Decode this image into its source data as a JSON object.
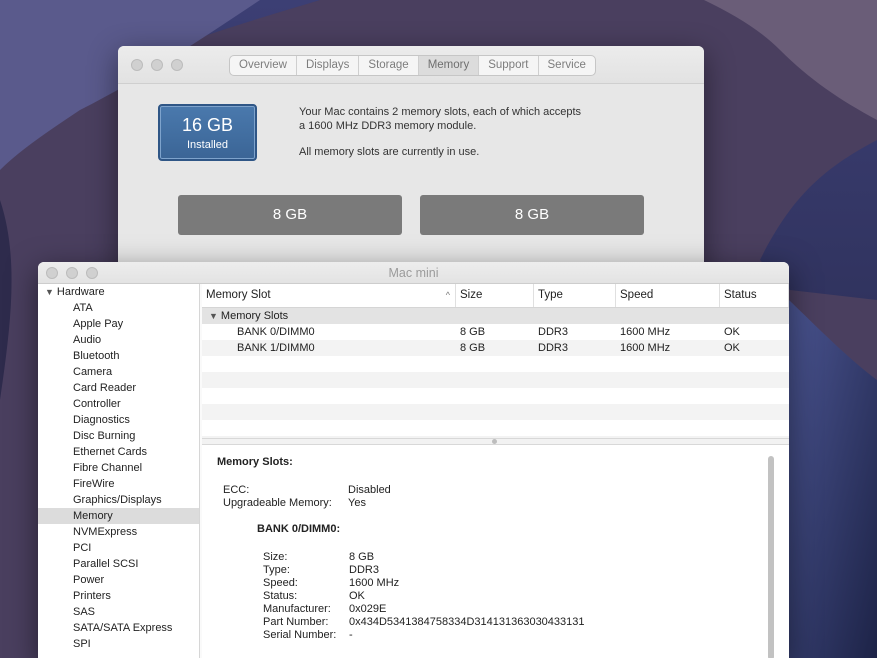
{
  "about_window": {
    "tabs": [
      {
        "label": "Overview",
        "active": false
      },
      {
        "label": "Displays",
        "active": false
      },
      {
        "label": "Storage",
        "active": false
      },
      {
        "label": "Memory",
        "active": true
      },
      {
        "label": "Support",
        "active": false
      },
      {
        "label": "Service",
        "active": false
      }
    ],
    "installed": {
      "amount": "16 GB",
      "label": "Installed"
    },
    "description_line1": "Your Mac contains 2 memory slots, each of which accepts",
    "description_line2": "a 1600 MHz DDR3 memory module.",
    "status_text": "All memory slots are currently in use.",
    "slots": [
      "8 GB",
      "8 GB"
    ]
  },
  "sysinfo_window": {
    "title": "Mac mini",
    "sidebar": {
      "group_label": "Hardware",
      "items": [
        "ATA",
        "Apple Pay",
        "Audio",
        "Bluetooth",
        "Camera",
        "Card Reader",
        "Controller",
        "Diagnostics",
        "Disc Burning",
        "Ethernet Cards",
        "Fibre Channel",
        "FireWire",
        "Graphics/Displays",
        "Memory",
        "NVMExpress",
        "PCI",
        "Parallel SCSI",
        "Power",
        "Printers",
        "SAS",
        "SATA/SATA Express",
        "SPI"
      ],
      "selected": "Memory"
    },
    "table": {
      "columns": [
        "Memory Slot",
        "Size",
        "Type",
        "Speed",
        "Status"
      ],
      "group_row": "Memory Slots",
      "rows": [
        [
          "BANK 0/DIMM0",
          "8 GB",
          "DDR3",
          "1600 MHz",
          "OK"
        ],
        [
          "BANK 1/DIMM0",
          "8 GB",
          "DDR3",
          "1600 MHz",
          "OK"
        ]
      ]
    },
    "detail": {
      "heading": "Memory Slots:",
      "ecc_label": "ECC:",
      "ecc_value": "Disabled",
      "upgradeable_label": "Upgradeable Memory:",
      "upgradeable_value": "Yes",
      "bank_heading": "BANK 0/DIMM0:",
      "bank_fields": [
        {
          "label": "Size:",
          "value": "8 GB"
        },
        {
          "label": "Type:",
          "value": "DDR3"
        },
        {
          "label": "Speed:",
          "value": "1600 MHz"
        },
        {
          "label": "Status:",
          "value": "OK"
        },
        {
          "label": "Manufacturer:",
          "value": "0x029E"
        },
        {
          "label": "Part Number:",
          "value": "0x434D5341384758334D314131363030433131"
        },
        {
          "label": "Serial Number:",
          "value": "-"
        }
      ]
    }
  }
}
